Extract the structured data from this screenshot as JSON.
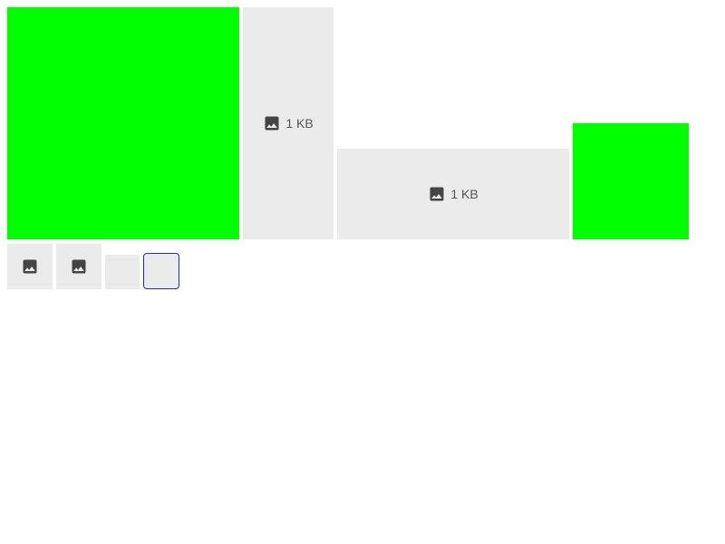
{
  "colors": {
    "image_fill": "#00ff00",
    "placeholder_bg": "#ebebeb",
    "focus_border": "#1a2fbf"
  },
  "gallery": {
    "row1": {
      "image_1": {
        "icon": "none"
      },
      "placeholder_1": {
        "icon": "image-icon",
        "size_label": "1 KB"
      },
      "placeholder_2": {
        "icon": "image-icon",
        "size_label": "1 KB"
      },
      "image_2": {
        "icon": "none"
      }
    },
    "row2": {
      "thumb_1": {
        "icon": "image-icon"
      },
      "thumb_2": {
        "icon": "image-icon"
      },
      "thumb_3": {
        "icon": "none"
      },
      "thumb_4": {
        "icon": "none",
        "state": "focused"
      }
    }
  }
}
